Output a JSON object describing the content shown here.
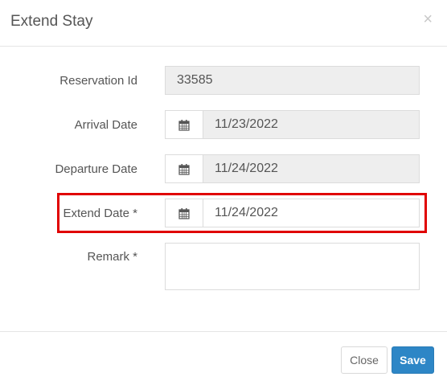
{
  "modal": {
    "title": "Extend Stay",
    "close_glyph": "×"
  },
  "form": {
    "reservation_id": {
      "label": "Reservation Id",
      "value": "33585"
    },
    "arrival_date": {
      "label": "Arrival Date",
      "value": "11/23/2022"
    },
    "departure_date": {
      "label": "Departure Date",
      "value": "11/24/2022"
    },
    "extend_date": {
      "label": "Extend Date *",
      "value": "11/24/2022"
    },
    "remark": {
      "label": "Remark *",
      "value": ""
    }
  },
  "footer": {
    "close_label": "Close",
    "save_label": "Save"
  },
  "colors": {
    "highlight": "#e00000",
    "save_button": "#2d86c6"
  },
  "icons": [
    "calendar-icon",
    "close-icon"
  ]
}
